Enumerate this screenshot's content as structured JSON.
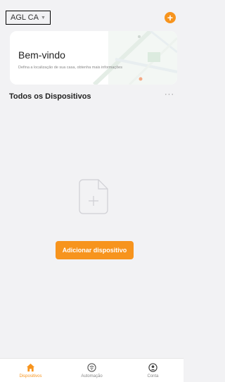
{
  "header": {
    "home_name": "AGL CA",
    "home_caret": "▼",
    "add_symbol": "+"
  },
  "welcome": {
    "title": "Bem-vindo",
    "subtitle": "Defina a localização de sua casa, obtenha mais informações"
  },
  "devices": {
    "section_title": "Todos os Dispositivos",
    "more_symbol": "···",
    "add_button_label": "Adicionar dispositivo"
  },
  "tabs": [
    {
      "label": "Dispositivos",
      "icon": "home-icon",
      "active": true
    },
    {
      "label": "Automação",
      "icon": "automation-icon",
      "active": false
    },
    {
      "label": "Conta",
      "icon": "account-icon",
      "active": false
    }
  ],
  "colors": {
    "accent": "#f7941d",
    "background": "#f2f2f4",
    "inactive": "#888888"
  }
}
